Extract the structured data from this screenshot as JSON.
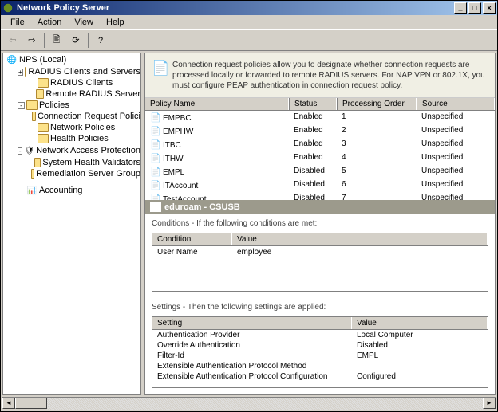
{
  "window": {
    "title": "Network Policy Server"
  },
  "menubar": {
    "items": [
      "File",
      "Action",
      "View",
      "Help"
    ]
  },
  "tree": {
    "root": "NPS (Local)",
    "radius": {
      "label": "RADIUS Clients and Servers",
      "children": [
        "RADIUS Clients",
        "Remote RADIUS Server"
      ]
    },
    "policies": {
      "label": "Policies",
      "children": [
        "Connection Request Polici",
        "Network Policies",
        "Health Policies"
      ]
    },
    "nap": {
      "label": "Network Access Protection",
      "children": [
        "System Health Validators",
        "Remediation Server Group"
      ]
    },
    "accounting": "Accounting"
  },
  "info": "Connection request policies allow you to designate whether connection requests are processed locally or forwarded to remote RADIUS servers. For NAP VPN or 802.1X, you must configure PEAP authentication in connection request policy.",
  "list": {
    "headers": {
      "name": "Policy Name",
      "status": "Status",
      "order": "Processing Order",
      "source": "Source"
    },
    "rows": [
      {
        "name": "EMPBC",
        "status": "Enabled",
        "order": "1",
        "source": "Unspecified"
      },
      {
        "name": "EMPHW",
        "status": "Enabled",
        "order": "2",
        "source": "Unspecified"
      },
      {
        "name": "ITBC",
        "status": "Enabled",
        "order": "3",
        "source": "Unspecified"
      },
      {
        "name": "ITHW",
        "status": "Enabled",
        "order": "4",
        "source": "Unspecified"
      },
      {
        "name": "EMPL",
        "status": "Disabled",
        "order": "5",
        "source": "Unspecified"
      },
      {
        "name": "ITAccount",
        "status": "Disabled",
        "order": "6",
        "source": "Unspecified"
      },
      {
        "name": "TestAccount",
        "status": "Disabled",
        "order": "7",
        "source": "Unspecified"
      }
    ]
  },
  "section": {
    "title": "eduroam - CSUSB"
  },
  "conditions": {
    "label": "Conditions - If the following conditions are met:",
    "headers": {
      "cond": "Condition",
      "val": "Value"
    },
    "rows": [
      {
        "cond": "User Name",
        "val": "employee"
      }
    ]
  },
  "settings": {
    "label": "Settings - Then the following settings are applied:",
    "headers": {
      "set": "Setting",
      "val": "Value"
    },
    "rows": [
      {
        "set": "Authentication Provider",
        "val": "Local Computer"
      },
      {
        "set": "Override Authentication",
        "val": "Disabled"
      },
      {
        "set": "Filter-Id",
        "val": "EMPL"
      },
      {
        "set": "Extensible Authentication Protocol Method",
        "val": ""
      },
      {
        "set": "Extensible Authentication Protocol Configuration",
        "val": "Configured"
      }
    ]
  }
}
